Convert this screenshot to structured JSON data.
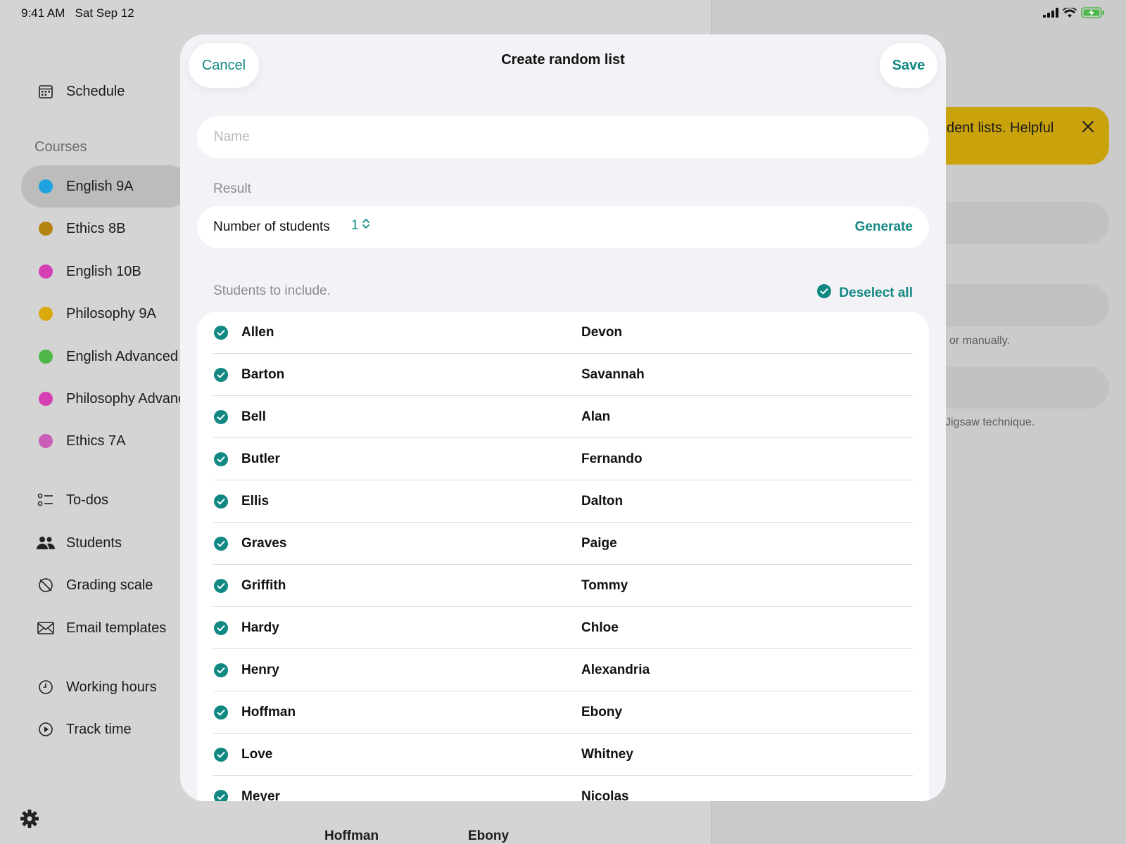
{
  "status": {
    "time": "9:41 AM",
    "date": "Sat Sep 12"
  },
  "sidebar": {
    "schedule_label": "Schedule",
    "courses_heading": "Courses",
    "courses": [
      {
        "label": "English 9A",
        "color": "#1ea3e0",
        "active": true
      },
      {
        "label": "Ethics 8B",
        "color": "#b58410"
      },
      {
        "label": "English 10B",
        "color": "#d43fb3"
      },
      {
        "label": "Philosophy 9A",
        "color": "#d9a90d"
      },
      {
        "label": "English Advanced",
        "color": "#4fb74a"
      },
      {
        "label": "Philosophy Advanc",
        "color": "#d43fb3"
      },
      {
        "label": "Ethics 7A",
        "color": "#c95db8"
      }
    ],
    "tools": [
      {
        "label": "To-dos",
        "icon": "todo-list-icon"
      },
      {
        "label": "Students",
        "icon": "people-icon"
      },
      {
        "label": "Grading scale",
        "icon": "grading-scale-icon"
      },
      {
        "label": "Email templates",
        "icon": "envelope-icon"
      }
    ],
    "time_tools": [
      {
        "label": "Working hours",
        "icon": "clock-icon"
      },
      {
        "label": "Track time",
        "icon": "play-circle-icon"
      }
    ]
  },
  "background_pane": {
    "banner_text": "dent lists. Helpful",
    "note1": "or manually.",
    "note2": "Jigsaw technique.",
    "behind_last": "Hoffman",
    "behind_first": "Ebony"
  },
  "modal": {
    "cancel_label": "Cancel",
    "title": "Create random list",
    "save_label": "Save",
    "name_placeholder": "Name",
    "result_label": "Result",
    "number_label": "Number of students",
    "number_value": "1",
    "generate_label": "Generate",
    "include_label": "Students to include.",
    "deselect_label": "Deselect all",
    "accent_color": "#128883",
    "students": [
      {
        "last": "Allen",
        "first": "Devon"
      },
      {
        "last": "Barton",
        "first": "Savannah"
      },
      {
        "last": "Bell",
        "first": "Alan"
      },
      {
        "last": "Butler",
        "first": "Fernando"
      },
      {
        "last": "Ellis",
        "first": "Dalton"
      },
      {
        "last": "Graves",
        "first": "Paige"
      },
      {
        "last": "Griffith",
        "first": "Tommy"
      },
      {
        "last": "Hardy",
        "first": "Chloe"
      },
      {
        "last": "Henry",
        "first": "Alexandria"
      },
      {
        "last": "Hoffman",
        "first": "Ebony"
      },
      {
        "last": "Love",
        "first": "Whitney"
      },
      {
        "last": "Meyer",
        "first": "Nicolas"
      }
    ]
  }
}
